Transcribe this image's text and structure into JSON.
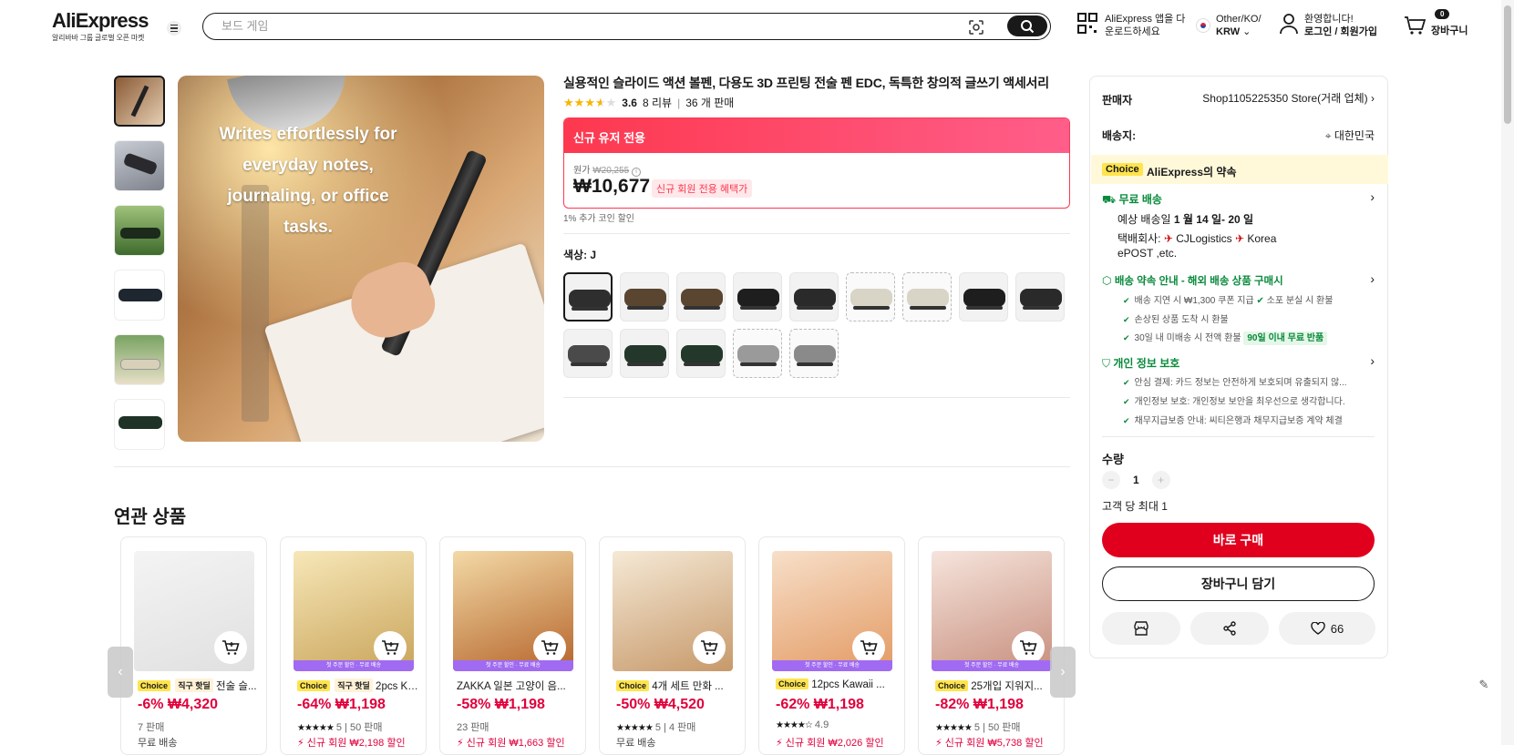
{
  "header": {
    "logo": "AliExpress",
    "logo_sub": "알리바바 그룹 글로벌 오픈 마켓",
    "search_placeholder": "보드 게임",
    "app_line1": "AliExpress 앱을 다",
    "app_line2": "운로드하세요",
    "region_line1": "Other/KO/",
    "region_line2": "KRW",
    "account_line1": "환영합니다!",
    "account_line2": "로그인 / 회원가입",
    "cart_count": "0",
    "cart_label": "장바구니"
  },
  "product": {
    "title": "실용적인 슬라이드 액션 볼펜, 다용도 3D 프린팅 전술 펜 EDC, 독특한 창의적 글쓰기 액세서리",
    "rating": "3.6",
    "rating_value": 3.6,
    "reviews": "8 리뷰",
    "sold": "36 개 판매",
    "image_caption": "Writes effortlessly for everyday notes, journaling, or office tasks.",
    "promo_banner": "신규 유저 전용",
    "orig_label": "원가",
    "orig_price": "₩20,255",
    "price": "₩10,677",
    "price_tag": "신규 회원 전용 혜택가",
    "coin_note": "1% 추가 코인 할인",
    "color_label": "색상: J"
  },
  "swatches": [
    {
      "case": "#2e2e2e",
      "selected": true
    },
    {
      "case": "#5a4630"
    },
    {
      "case": "#5a4630"
    },
    {
      "case": "#1e1e1e"
    },
    {
      "case": "#2a2a2a"
    },
    {
      "case": "#d8d4c6",
      "dashed": true
    },
    {
      "case": "#d8d4c6",
      "dashed": true
    },
    {
      "case": "#1e1e1e"
    },
    {
      "case": "#2a2a2a"
    },
    {
      "case": "#4a4a4a"
    },
    {
      "case": "#23372a"
    },
    {
      "case": "#23372a"
    },
    {
      "case": "#9a9a9a",
      "dashed": true
    },
    {
      "case": "#8a8a8a",
      "dashed": true
    }
  ],
  "related": {
    "title": "연관 상품",
    "items": [
      {
        "choice": "Choice",
        "hot": "직구 핫딜",
        "name": "전술 슬...",
        "price": "-6% ₩4,320",
        "red": true,
        "meta": "7 판매",
        "line4": "무료 배송",
        "line4_red": false,
        "band": ""
      },
      {
        "choice": "Choice",
        "hot": "직구 핫딜",
        "name": "2pcs Ka...",
        "price": "-64% ₩1,198",
        "red": true,
        "stars": "★★★★★",
        "meta": "5 | 50 판매",
        "line4": "⚡ 신규 회원 ₩2,198 할인",
        "line4_red": true,
        "band": "첫 주문 할인 · 무료 배송"
      },
      {
        "choice": "",
        "hot": "",
        "name": "ZAKKA 일본 고양이 음...",
        "price": "-58% ₩1,198",
        "red": true,
        "meta": "23 판매",
        "line4": "⚡ 신규 회원 ₩1,663 할인",
        "line4_red": true,
        "band": "첫 주문 할인 · 무료 배송"
      },
      {
        "choice": "Choice",
        "hot": "",
        "name": "4개 세트 만화 ...",
        "price": "-50% ₩4,520",
        "red": true,
        "stars": "★★★★★",
        "meta": "5 | 4 판매",
        "line4": "무료 배송",
        "line4_red": false,
        "band": ""
      },
      {
        "choice": "Choice",
        "hot": "",
        "name": "12pcs Kawaii ...",
        "price": "-62% ₩1,198",
        "red": true,
        "stars": "★★★★☆",
        "meta": "4.9",
        "line4": "⚡ 신규 회원 ₩2,026 할인",
        "line4_red": true,
        "band": "첫 주문 할인 · 무료 배송"
      },
      {
        "choice": "Choice",
        "hot": "",
        "name": "25개입 지워지...",
        "price": "-82% ₩1,198",
        "red": true,
        "stars": "★★★★★",
        "meta": "5 | 50 판매",
        "line4": "⚡ 신규 회원 ₩5,738 할인",
        "line4_red": true,
        "band": "첫 주문 할인 · 무료 배송"
      }
    ]
  },
  "side": {
    "seller_label": "판매자",
    "seller_value": "Shop1105225350 Store(거래 업체)",
    "ship_to_label": "배송지:",
    "ship_to_value": "대한민국",
    "choice_chip": "Choice",
    "choice_promise": "AliExpress의 약속",
    "free_ship": "무료 배송",
    "eta_prefix": "예상 배송일",
    "eta": "1 월 14 일- 20 일",
    "carrier_label": "택배회사:",
    "carrier1": "CJLogistics",
    "carrier2": "Korea",
    "carrier3": "ePOST ,etc.",
    "promise_title": "배송 약속 안내 - 해외 배송 상품 구매시",
    "promise1a": "배송 지연 시 ₩1,300 쿠폰 지급",
    "promise1b": "소포 분실 시 환불",
    "promise2": "손상된 상품 도착 시 환불",
    "promise3": "30일 내 미배송 시 전액 환불",
    "promise3_tag": "90일 이내 무료 반품",
    "privacy_title": "개인 정보 보호",
    "privacy1": "안심 결제: 카드 정보는 안전하게 보호되며 유출되지 않...",
    "privacy2": "개인정보 보호: 개인정보 보안을 최우선으로 생각합니다.",
    "privacy3": "채무지급보증 안내: 씨티은행과 채무지급보증 계약 체결",
    "qty_label": "수량",
    "qty": "1",
    "qty_limit": "고객 당 최대 1",
    "buy_now": "바로 구매",
    "add_cart": "장바구니 담기",
    "wish_count": "66"
  }
}
